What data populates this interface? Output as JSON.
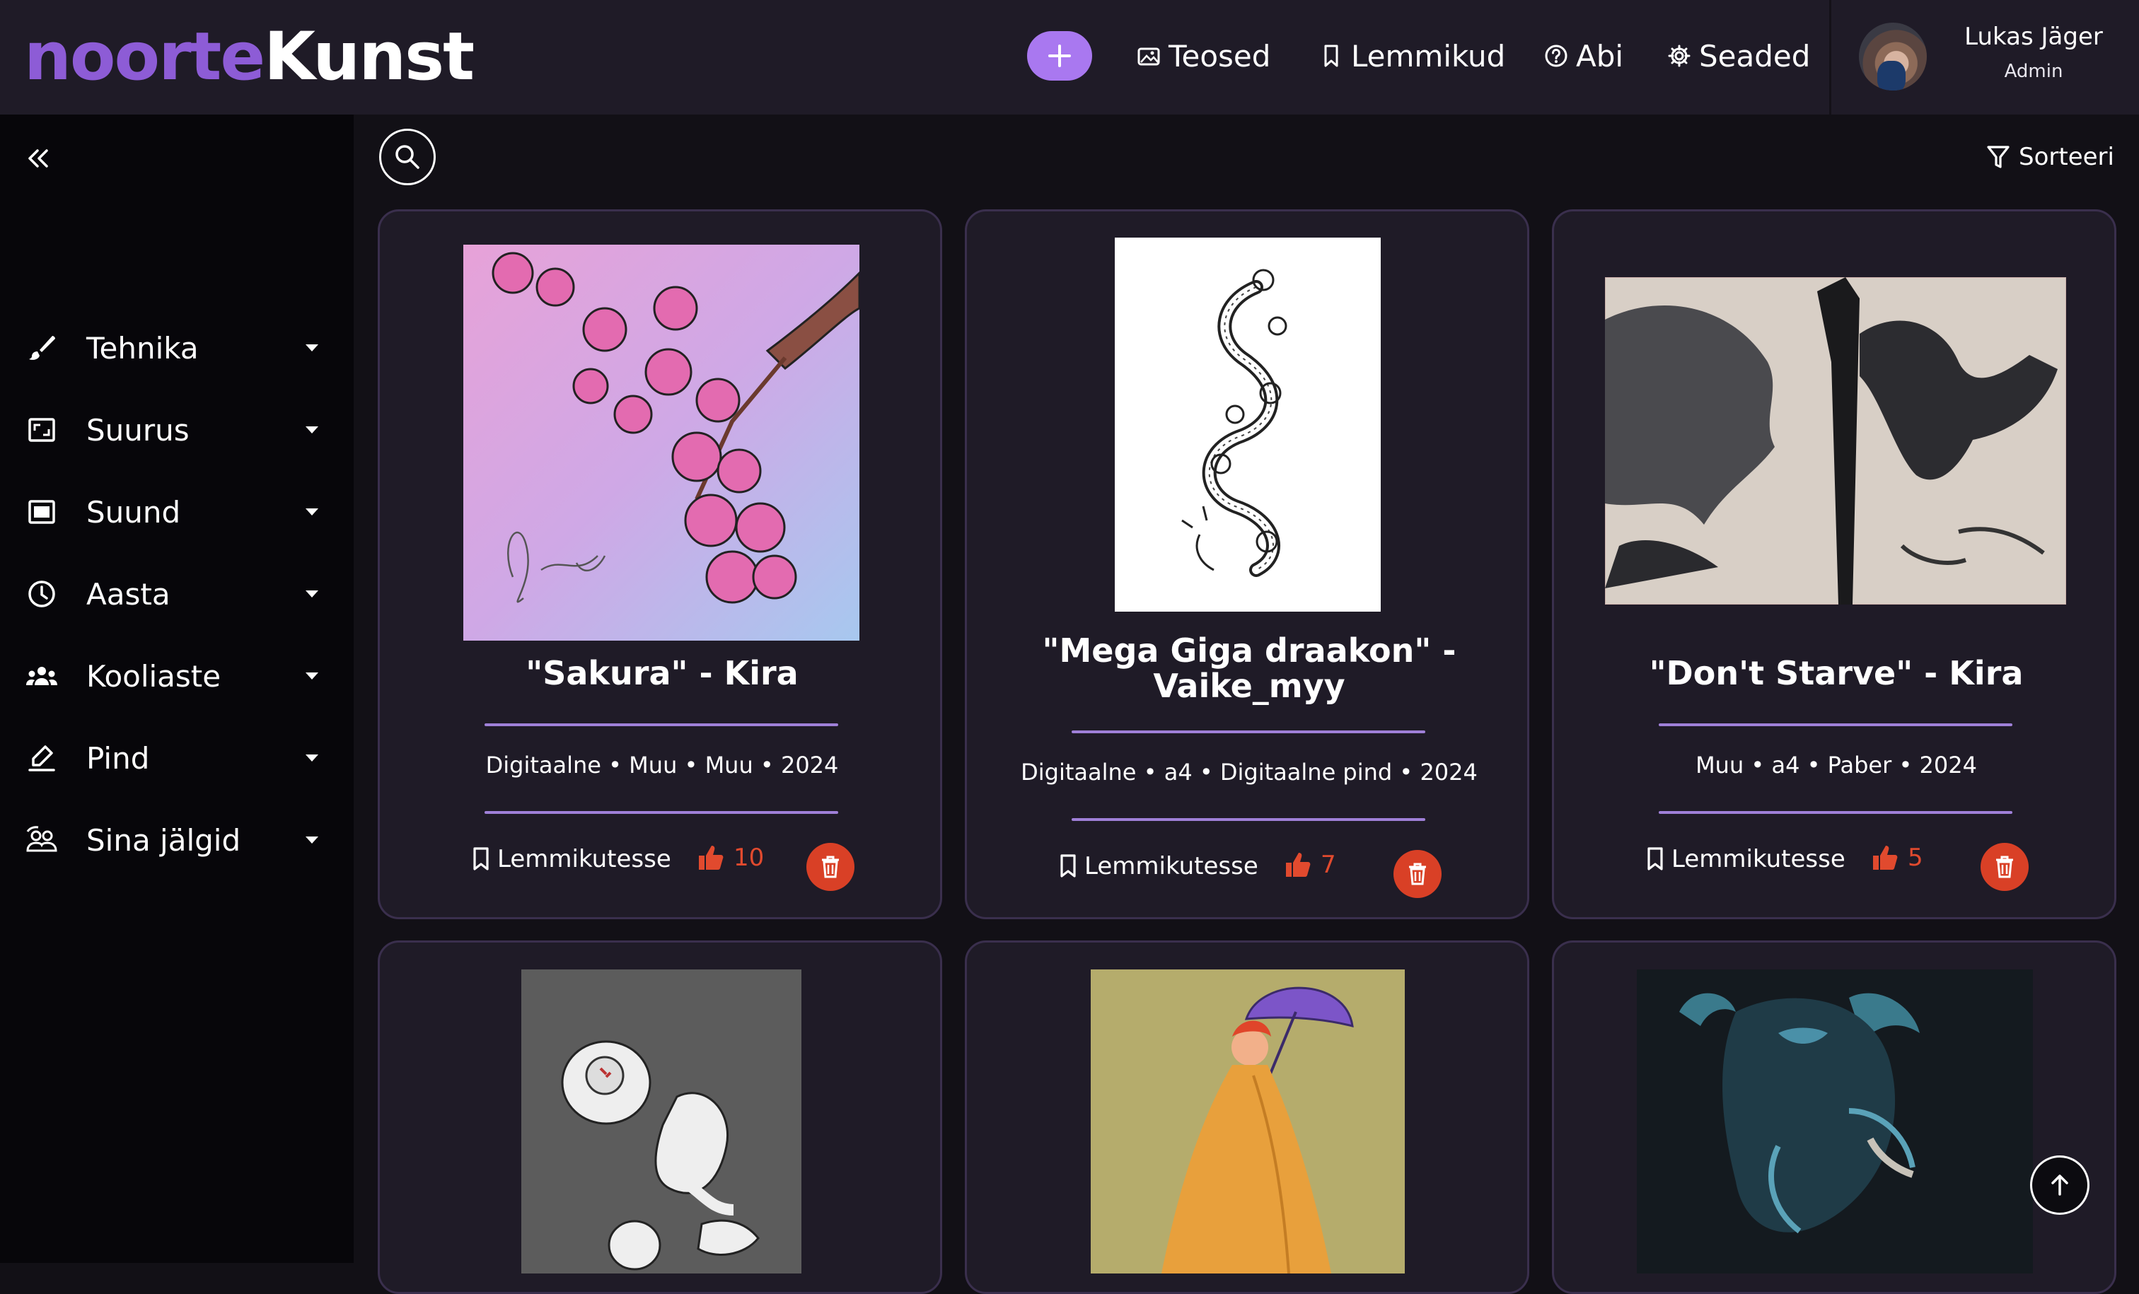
{
  "brand": {
    "part1": "noorte",
    "part2": "Kunst"
  },
  "header": {
    "nav": [
      {
        "label": "Teosed",
        "icon": "gallery-icon"
      },
      {
        "label": "Lemmikud",
        "icon": "bookmark-icon"
      },
      {
        "label": "Abi",
        "icon": "help-icon"
      },
      {
        "label": "Seaded",
        "icon": "gear-icon"
      }
    ],
    "add_icon": "plus-icon",
    "user": {
      "name": "Lukas Jäger",
      "role": "Admin"
    }
  },
  "sidebar": {
    "collapse_icon": "double-chevron-left-icon",
    "filters": [
      {
        "label": "Tehnika",
        "icon": "brush-icon"
      },
      {
        "label": "Suurus",
        "icon": "size-icon"
      },
      {
        "label": "Suund",
        "icon": "orientation-icon"
      },
      {
        "label": "Aasta",
        "icon": "clock-icon"
      },
      {
        "label": "Kooliaste",
        "icon": "group-icon"
      },
      {
        "label": "Pind",
        "icon": "pen-surface-icon"
      },
      {
        "label": "Sina jälgid",
        "icon": "following-icon"
      }
    ]
  },
  "toolbar": {
    "sort_label": "Sorteeri",
    "search_icon": "search-icon",
    "filter_icon": "filter-icon"
  },
  "artworks": [
    {
      "title": "\"Sakura\" - Kira",
      "meta": "Digitaalne • Muu • Muu • 2024",
      "favorite_label": "Lemmikutesse",
      "likes": "10"
    },
    {
      "title": "\"Mega Giga draakon\" - Vaike_myy",
      "meta": "Digitaalne • a4 • Digitaalne pind • 2024",
      "favorite_label": "Lemmikutesse",
      "likes": "7"
    },
    {
      "title": "\"Don't Starve\" - Kira",
      "meta": "Muu • a4 • Paber • 2024",
      "favorite_label": "Lemmikutesse",
      "likes": "5"
    }
  ],
  "colors": {
    "accent": "#a978f0",
    "logo_purple": "#8d5cd6",
    "danger": "#d94026",
    "card_bg": "#1f1b27",
    "rule": "#9f80d8"
  }
}
